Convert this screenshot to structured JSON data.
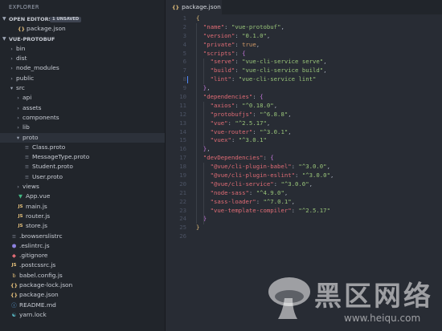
{
  "sidebar": {
    "title": "EXPLORER",
    "open_editors": {
      "label": "OPEN EDITORS",
      "badge": "1 UNSAVED",
      "items": [
        {
          "label": "package.json",
          "icon": "json-icon"
        }
      ]
    },
    "project": {
      "label": "VUE-PROTOBUF",
      "items": [
        {
          "label": "bin",
          "type": "folder",
          "depth": 0,
          "open": false
        },
        {
          "label": "dist",
          "type": "folder",
          "depth": 0,
          "open": false
        },
        {
          "label": "node_modules",
          "type": "folder",
          "depth": 0,
          "open": false
        },
        {
          "label": "public",
          "type": "folder",
          "depth": 0,
          "open": false
        },
        {
          "label": "src",
          "type": "folder",
          "depth": 0,
          "open": true
        },
        {
          "label": "api",
          "type": "folder",
          "depth": 1,
          "open": false
        },
        {
          "label": "assets",
          "type": "folder",
          "depth": 1,
          "open": false
        },
        {
          "label": "components",
          "type": "folder",
          "depth": 1,
          "open": false
        },
        {
          "label": "lib",
          "type": "folder",
          "depth": 1,
          "open": false
        },
        {
          "label": "proto",
          "type": "folder",
          "depth": 1,
          "open": true,
          "selected": true
        },
        {
          "label": "Class.proto",
          "type": "file",
          "depth": 2,
          "icon": "file-icon"
        },
        {
          "label": "MessageType.proto",
          "type": "file",
          "depth": 2,
          "icon": "file-icon"
        },
        {
          "label": "Student.proto",
          "type": "file",
          "depth": 2,
          "icon": "file-icon"
        },
        {
          "label": "User.proto",
          "type": "file",
          "depth": 2,
          "icon": "file-icon"
        },
        {
          "label": "views",
          "type": "folder",
          "depth": 1,
          "open": false
        },
        {
          "label": "App.vue",
          "type": "file",
          "depth": 1,
          "icon": "vue-icon"
        },
        {
          "label": "main.js",
          "type": "file",
          "depth": 1,
          "icon": "js-icon"
        },
        {
          "label": "router.js",
          "type": "file",
          "depth": 1,
          "icon": "js-icon"
        },
        {
          "label": "store.js",
          "type": "file",
          "depth": 1,
          "icon": "js-icon"
        },
        {
          "label": ".browserslistrc",
          "type": "file",
          "depth": 0,
          "icon": "file-icon"
        },
        {
          "label": ".eslintrc.js",
          "type": "file",
          "depth": 0,
          "icon": "eslint-icon"
        },
        {
          "label": ".gitignore",
          "type": "file",
          "depth": 0,
          "icon": "git-icon"
        },
        {
          "label": ".postcssrc.js",
          "type": "file",
          "depth": 0,
          "icon": "js-icon"
        },
        {
          "label": "babel.config.js",
          "type": "file",
          "depth": 0,
          "icon": "babel-icon"
        },
        {
          "label": "package-lock.json",
          "type": "file",
          "depth": 0,
          "icon": "json-icon"
        },
        {
          "label": "package.json",
          "type": "file",
          "depth": 0,
          "icon": "json-icon"
        },
        {
          "label": "README.md",
          "type": "file",
          "depth": 0,
          "icon": "markdown-icon"
        },
        {
          "label": "yarn.lock",
          "type": "file",
          "depth": 0,
          "icon": "yarn-icon"
        }
      ]
    }
  },
  "tab": {
    "label": "package.json",
    "icon": "json-icon"
  },
  "editor": {
    "lines": [
      [
        [
          "{",
          "t-brace"
        ]
      ],
      [
        [
          "  ",
          ""
        ],
        [
          "\"name\"",
          "t-key"
        ],
        [
          ": ",
          "t-punc"
        ],
        [
          "\"vue-protobuf\"",
          "t-str"
        ],
        [
          ",",
          "t-punc"
        ]
      ],
      [
        [
          "  ",
          ""
        ],
        [
          "\"version\"",
          "t-key"
        ],
        [
          ": ",
          "t-punc"
        ],
        [
          "\"0.1.0\"",
          "t-str"
        ],
        [
          ",",
          "t-punc"
        ]
      ],
      [
        [
          "  ",
          ""
        ],
        [
          "\"private\"",
          "t-key"
        ],
        [
          ": ",
          "t-punc"
        ],
        [
          "true",
          "t-kw"
        ],
        [
          ",",
          "t-punc"
        ]
      ],
      [
        [
          "  ",
          ""
        ],
        [
          "\"scripts\"",
          "t-key"
        ],
        [
          ": ",
          "t-punc"
        ],
        [
          "{",
          "t-brace2"
        ]
      ],
      [
        [
          "    ",
          ""
        ],
        [
          "\"serve\"",
          "t-key"
        ],
        [
          ": ",
          "t-punc"
        ],
        [
          "\"vue-cli-service serve\"",
          "t-str"
        ],
        [
          ",",
          "t-punc"
        ]
      ],
      [
        [
          "    ",
          ""
        ],
        [
          "\"build\"",
          "t-key"
        ],
        [
          ": ",
          "t-punc"
        ],
        [
          "\"vue-cli-service build\"",
          "t-str"
        ],
        [
          ",",
          "t-punc"
        ]
      ],
      [
        [
          "    ",
          ""
        ],
        [
          "\"lint\"",
          "t-key"
        ],
        [
          ": ",
          "t-punc"
        ],
        [
          "\"vue-cli-service lint\"",
          "t-str"
        ]
      ],
      [
        [
          "  ",
          ""
        ],
        [
          "}",
          "t-brace2"
        ],
        [
          ",",
          "t-punc"
        ]
      ],
      [
        [
          "  ",
          ""
        ],
        [
          "\"dependencies\"",
          "t-key"
        ],
        [
          ": ",
          "t-punc"
        ],
        [
          "{",
          "t-brace2"
        ]
      ],
      [
        [
          "    ",
          ""
        ],
        [
          "\"axios\"",
          "t-key"
        ],
        [
          ": ",
          "t-punc"
        ],
        [
          "\"^0.18.0\"",
          "t-str"
        ],
        [
          ",",
          "t-punc"
        ]
      ],
      [
        [
          "    ",
          ""
        ],
        [
          "\"protobufjs\"",
          "t-key"
        ],
        [
          ": ",
          "t-punc"
        ],
        [
          "\"^6.8.8\"",
          "t-str"
        ],
        [
          ",",
          "t-punc"
        ]
      ],
      [
        [
          "    ",
          ""
        ],
        [
          "\"vue\"",
          "t-key"
        ],
        [
          ": ",
          "t-punc"
        ],
        [
          "\"^2.5.17\"",
          "t-str"
        ],
        [
          ",",
          "t-punc"
        ]
      ],
      [
        [
          "    ",
          ""
        ],
        [
          "\"vue-router\"",
          "t-key"
        ],
        [
          ": ",
          "t-punc"
        ],
        [
          "\"^3.0.1\"",
          "t-str"
        ],
        [
          ",",
          "t-punc"
        ]
      ],
      [
        [
          "    ",
          ""
        ],
        [
          "\"vuex\"",
          "t-key"
        ],
        [
          ": ",
          "t-punc"
        ],
        [
          "\"^3.0.1\"",
          "t-str"
        ]
      ],
      [
        [
          "  ",
          ""
        ],
        [
          "}",
          "t-brace2"
        ],
        [
          ",",
          "t-punc"
        ]
      ],
      [
        [
          "  ",
          ""
        ],
        [
          "\"devDependencies\"",
          "t-key"
        ],
        [
          ": ",
          "t-punc"
        ],
        [
          "{",
          "t-brace2"
        ]
      ],
      [
        [
          "    ",
          ""
        ],
        [
          "\"@vue/cli-plugin-babel\"",
          "t-key"
        ],
        [
          ": ",
          "t-punc"
        ],
        [
          "\"^3.0.0\"",
          "t-str"
        ],
        [
          ",",
          "t-punc"
        ]
      ],
      [
        [
          "    ",
          ""
        ],
        [
          "\"@vue/cli-plugin-eslint\"",
          "t-key"
        ],
        [
          ": ",
          "t-punc"
        ],
        [
          "\"^3.0.0\"",
          "t-str"
        ],
        [
          ",",
          "t-punc"
        ]
      ],
      [
        [
          "    ",
          ""
        ],
        [
          "\"@vue/cli-service\"",
          "t-key"
        ],
        [
          ": ",
          "t-punc"
        ],
        [
          "\"^3.0.0\"",
          "t-str"
        ],
        [
          ",",
          "t-punc"
        ]
      ],
      [
        [
          "    ",
          ""
        ],
        [
          "\"node-sass\"",
          "t-key"
        ],
        [
          ": ",
          "t-punc"
        ],
        [
          "\"^4.9.0\"",
          "t-str"
        ],
        [
          ",",
          "t-punc"
        ]
      ],
      [
        [
          "    ",
          ""
        ],
        [
          "\"sass-loader\"",
          "t-key"
        ],
        [
          ": ",
          "t-punc"
        ],
        [
          "\"^7.0.1\"",
          "t-str"
        ],
        [
          ",",
          "t-punc"
        ]
      ],
      [
        [
          "    ",
          ""
        ],
        [
          "\"vue-template-compiler\"",
          "t-key"
        ],
        [
          ": ",
          "t-punc"
        ],
        [
          "\"^2.5.17\"",
          "t-str"
        ]
      ],
      [
        [
          "  ",
          ""
        ],
        [
          "}",
          "t-brace2"
        ]
      ],
      [
        [
          "}",
          "t-brace"
        ]
      ],
      []
    ]
  },
  "watermark": {
    "text": "黑区网络",
    "url": "www.heiqu.com"
  }
}
